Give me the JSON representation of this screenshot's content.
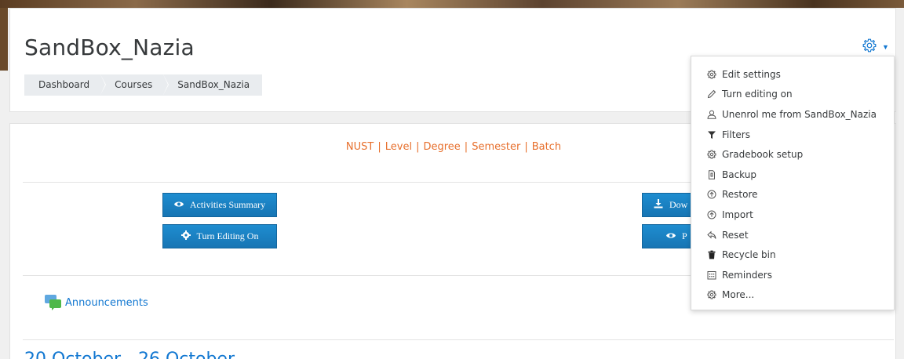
{
  "header": {
    "title": "SandBox_Nazia",
    "breadcrumb": [
      "Dashboard",
      "Courses",
      "SandBox_Nazia"
    ]
  },
  "banner": {
    "items": [
      "NUST",
      "Level",
      "Degree",
      "Semester",
      "Batch"
    ],
    "separator": "|",
    "color": "#e76f2c"
  },
  "buttons": {
    "activities_summary": "Activities Summary",
    "turn_editing_on": "Turn Editing On",
    "download_partial": "Dow",
    "second_partial": "P"
  },
  "announcements": "Announcements",
  "week_title": "20 October - 26 October",
  "menu": {
    "items": [
      {
        "label": "Edit settings",
        "icon": "gear-icon"
      },
      {
        "label": "Turn editing on",
        "icon": "pencil-icon"
      },
      {
        "label": "Unenrol me from SandBox_Nazia",
        "icon": "user-icon"
      },
      {
        "label": "Filters",
        "icon": "filter-icon"
      },
      {
        "label": "Gradebook setup",
        "icon": "gear-icon"
      },
      {
        "label": "Backup",
        "icon": "file-icon"
      },
      {
        "label": "Restore",
        "icon": "upload-icon"
      },
      {
        "label": "Import",
        "icon": "upload-icon"
      },
      {
        "label": "Reset",
        "icon": "reply-icon"
      },
      {
        "label": "Recycle bin",
        "icon": "trash-icon"
      },
      {
        "label": "Reminders",
        "icon": "calendar-icon"
      },
      {
        "label": "More...",
        "icon": "gear-icon"
      }
    ]
  },
  "colors": {
    "link": "#1177d1",
    "button": "#1a7fc2",
    "accent_orange": "#e76f2c"
  }
}
